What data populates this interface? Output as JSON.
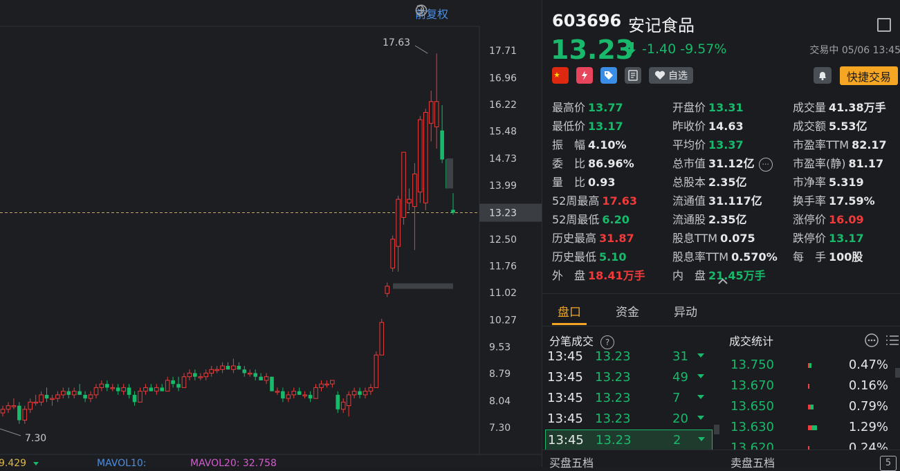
{
  "toolbar": {
    "adjust": "前复权"
  },
  "chart": {
    "price_labels": [
      "17.71",
      "16.96",
      "16.22",
      "15.48",
      "14.73",
      "13.99",
      "13.23",
      "12.50",
      "11.76",
      "11.02",
      "10.27",
      "9.53",
      "8.79",
      "8.04",
      "7.30"
    ],
    "current_price_tag": "13.23",
    "high_annotation": "17.63",
    "low_annotation": "7.30",
    "mavol_left": "9.429",
    "mavol10": "MAVOL10:",
    "mavol20": "MAVOL20: 32.758"
  },
  "chart_data": {
    "type": "candlestick",
    "series": [
      {
        "o": 7.7,
        "h": 7.9,
        "l": 7.6,
        "c": 7.8
      },
      {
        "o": 7.8,
        "h": 8.0,
        "l": 7.7,
        "c": 7.9
      },
      {
        "o": 7.9,
        "h": 8.1,
        "l": 7.8,
        "c": 7.9
      },
      {
        "o": 7.9,
        "h": 8.0,
        "l": 7.4,
        "c": 7.5
      },
      {
        "o": 7.5,
        "h": 7.9,
        "l": 7.4,
        "c": 7.8
      },
      {
        "o": 7.8,
        "h": 8.1,
        "l": 7.7,
        "c": 8.0
      },
      {
        "o": 8.0,
        "h": 8.2,
        "l": 7.9,
        "c": 8.0
      },
      {
        "o": 8.0,
        "h": 8.3,
        "l": 7.9,
        "c": 8.2
      },
      {
        "o": 8.2,
        "h": 8.4,
        "l": 8.0,
        "c": 8.1
      },
      {
        "o": 8.1,
        "h": 8.2,
        "l": 7.9,
        "c": 8.1
      },
      {
        "o": 8.1,
        "h": 8.3,
        "l": 8.0,
        "c": 8.2
      },
      {
        "o": 8.2,
        "h": 8.4,
        "l": 8.1,
        "c": 8.3
      },
      {
        "o": 8.3,
        "h": 8.4,
        "l": 8.1,
        "c": 8.2
      },
      {
        "o": 8.2,
        "h": 8.4,
        "l": 8.1,
        "c": 8.3
      },
      {
        "o": 8.3,
        "h": 8.5,
        "l": 8.2,
        "c": 8.2
      },
      {
        "o": 8.2,
        "h": 8.3,
        "l": 8.0,
        "c": 8.1
      },
      {
        "o": 8.1,
        "h": 8.3,
        "l": 8.0,
        "c": 8.2
      },
      {
        "o": 8.2,
        "h": 8.5,
        "l": 8.1,
        "c": 8.4
      },
      {
        "o": 8.4,
        "h": 8.6,
        "l": 8.3,
        "c": 8.5
      },
      {
        "o": 8.5,
        "h": 8.6,
        "l": 8.3,
        "c": 8.4
      },
      {
        "o": 8.4,
        "h": 8.5,
        "l": 8.3,
        "c": 8.4
      },
      {
        "o": 8.4,
        "h": 8.5,
        "l": 8.2,
        "c": 8.3
      },
      {
        "o": 8.3,
        "h": 8.5,
        "l": 8.2,
        "c": 8.4
      },
      {
        "o": 8.4,
        "h": 8.5,
        "l": 8.1,
        "c": 8.2
      },
      {
        "o": 8.2,
        "h": 8.3,
        "l": 7.9,
        "c": 8.0
      },
      {
        "o": 8.0,
        "h": 8.4,
        "l": 8.0,
        "c": 8.3
      },
      {
        "o": 8.3,
        "h": 8.5,
        "l": 8.2,
        "c": 8.4
      },
      {
        "o": 8.4,
        "h": 8.5,
        "l": 8.3,
        "c": 8.3
      },
      {
        "o": 8.3,
        "h": 8.5,
        "l": 8.2,
        "c": 8.4
      },
      {
        "o": 8.4,
        "h": 8.5,
        "l": 8.3,
        "c": 8.3
      },
      {
        "o": 8.3,
        "h": 8.7,
        "l": 8.3,
        "c": 8.6
      },
      {
        "o": 8.6,
        "h": 8.7,
        "l": 8.4,
        "c": 8.5
      },
      {
        "o": 8.5,
        "h": 8.7,
        "l": 8.3,
        "c": 8.4
      },
      {
        "o": 8.4,
        "h": 8.8,
        "l": 8.4,
        "c": 8.7
      },
      {
        "o": 8.7,
        "h": 8.9,
        "l": 8.6,
        "c": 8.8
      },
      {
        "o": 8.8,
        "h": 8.9,
        "l": 8.6,
        "c": 8.7
      },
      {
        "o": 8.7,
        "h": 8.8,
        "l": 8.6,
        "c": 8.7
      },
      {
        "o": 8.7,
        "h": 8.9,
        "l": 8.6,
        "c": 8.8
      },
      {
        "o": 8.8,
        "h": 9.0,
        "l": 8.7,
        "c": 8.9
      },
      {
        "o": 8.9,
        "h": 9.0,
        "l": 8.8,
        "c": 8.9
      },
      {
        "o": 8.9,
        "h": 9.1,
        "l": 8.8,
        "c": 9.0
      },
      {
        "o": 9.0,
        "h": 9.1,
        "l": 8.9,
        "c": 8.9
      },
      {
        "o": 8.9,
        "h": 9.2,
        "l": 8.8,
        "c": 9.0
      },
      {
        "o": 9.0,
        "h": 9.1,
        "l": 8.9,
        "c": 8.9
      },
      {
        "o": 8.9,
        "h": 9.0,
        "l": 8.7,
        "c": 8.8
      },
      {
        "o": 8.8,
        "h": 8.9,
        "l": 8.7,
        "c": 8.8
      },
      {
        "o": 8.8,
        "h": 8.9,
        "l": 8.6,
        "c": 8.7
      },
      {
        "o": 8.7,
        "h": 8.8,
        "l": 8.6,
        "c": 8.6
      },
      {
        "o": 8.6,
        "h": 8.8,
        "l": 8.5,
        "c": 8.7
      },
      {
        "o": 8.7,
        "h": 8.7,
        "l": 8.3,
        "c": 8.3
      },
      {
        "o": 8.3,
        "h": 8.4,
        "l": 8.2,
        "c": 8.3
      },
      {
        "o": 8.3,
        "h": 8.4,
        "l": 8.0,
        "c": 8.1
      },
      {
        "o": 8.1,
        "h": 8.3,
        "l": 8.0,
        "c": 8.2
      },
      {
        "o": 8.2,
        "h": 8.4,
        "l": 8.1,
        "c": 8.3
      },
      {
        "o": 8.3,
        "h": 8.4,
        "l": 8.2,
        "c": 8.2
      },
      {
        "o": 8.2,
        "h": 8.3,
        "l": 8.1,
        "c": 8.2
      },
      {
        "o": 8.2,
        "h": 8.3,
        "l": 8.0,
        "c": 8.1
      },
      {
        "o": 8.1,
        "h": 8.5,
        "l": 8.1,
        "c": 8.4
      },
      {
        "o": 8.4,
        "h": 8.6,
        "l": 8.3,
        "c": 8.5
      },
      {
        "o": 8.5,
        "h": 8.6,
        "l": 8.4,
        "c": 8.5
      },
      {
        "o": 8.5,
        "h": 8.6,
        "l": 8.4,
        "c": 8.6
      },
      {
        "o": 8.2,
        "h": 8.3,
        "l": 7.7,
        "c": 7.8
      },
      {
        "o": 7.8,
        "h": 8.1,
        "l": 7.7,
        "c": 8.0
      },
      {
        "o": 7.9,
        "h": 8.3,
        "l": 7.6,
        "c": 8.2
      },
      {
        "o": 8.2,
        "h": 8.4,
        "l": 8.1,
        "c": 8.3
      },
      {
        "o": 8.3,
        "h": 8.4,
        "l": 8.1,
        "c": 8.2
      },
      {
        "o": 8.2,
        "h": 8.4,
        "l": 8.1,
        "c": 8.3
      },
      {
        "o": 8.3,
        "h": 8.5,
        "l": 8.2,
        "c": 8.4
      },
      {
        "o": 8.4,
        "h": 9.4,
        "l": 8.4,
        "c": 9.3
      },
      {
        "o": 9.3,
        "h": 10.3,
        "l": 9.3,
        "c": 10.2
      },
      {
        "o": 11.0,
        "h": 11.3,
        "l": 10.9,
        "c": 11.2
      },
      {
        "o": 11.7,
        "h": 12.6,
        "l": 11.6,
        "c": 12.5
      },
      {
        "o": 12.3,
        "h": 13.7,
        "l": 11.6,
        "c": 13.6
      },
      {
        "o": 13.1,
        "h": 14.9,
        "l": 12.9,
        "c": 14.9
      },
      {
        "o": 13.5,
        "h": 13.9,
        "l": 13.3,
        "c": 13.6
      },
      {
        "o": 13.4,
        "h": 14.6,
        "l": 12.2,
        "c": 14.3
      },
      {
        "o": 13.8,
        "h": 15.9,
        "l": 13.5,
        "c": 15.8
      },
      {
        "o": 13.5,
        "h": 16.1,
        "l": 13.3,
        "c": 16.0
      },
      {
        "o": 15.7,
        "h": 16.6,
        "l": 15.2,
        "c": 16.3
      },
      {
        "o": 15.6,
        "h": 17.63,
        "l": 15.0,
        "c": 16.3
      },
      {
        "o": 15.5,
        "h": 16.2,
        "l": 14.6,
        "c": 14.7
      },
      {
        "o": 14.7,
        "h": 14.7,
        "l": 13.9,
        "c": 13.9
      },
      {
        "o": 13.31,
        "h": 13.77,
        "l": 13.17,
        "c": 13.23
      }
    ],
    "ylim": [
      7.3,
      17.71
    ]
  },
  "quote": {
    "code": "603696",
    "name": "安记食品",
    "price": "13.23",
    "change": "-1.40",
    "change_pct": "-9.57%",
    "status": "交易中 05/06 13:45",
    "watch": "自选",
    "fast_trade": "快捷交易"
  },
  "stats_col1": [
    {
      "label": "最高价",
      "value": "13.77",
      "color": "g"
    },
    {
      "label": "最低价",
      "value": "13.17",
      "color": "g"
    },
    {
      "label": "振　幅",
      "value": "4.10%",
      "color": "w"
    },
    {
      "label": "委　比",
      "value": "86.96%",
      "color": "w"
    },
    {
      "label": "量　比",
      "value": "0.93",
      "color": "w"
    },
    {
      "label": "52周最高",
      "value": "17.63",
      "color": "r"
    },
    {
      "label": "52周最低",
      "value": "6.20",
      "color": "g"
    },
    {
      "label": "历史最高",
      "value": "31.87",
      "color": "r"
    },
    {
      "label": "历史最低",
      "value": "5.10",
      "color": "g"
    },
    {
      "label": "外　盘",
      "value": "18.41万手",
      "color": "r"
    }
  ],
  "stats_col2": [
    {
      "label": "开盘价",
      "value": "13.31",
      "color": "g"
    },
    {
      "label": "昨收价",
      "value": "14.63",
      "color": "w"
    },
    {
      "label": "平均价",
      "value": "13.37",
      "color": "g"
    },
    {
      "label": "总市值",
      "value": "31.12亿",
      "color": "w"
    },
    {
      "label": "总股本",
      "value": "2.35亿",
      "color": "w"
    },
    {
      "label": "流通值",
      "value": "31.117亿",
      "color": "w"
    },
    {
      "label": "流通股",
      "value": "2.35亿",
      "color": "w"
    },
    {
      "label": "股息TTM",
      "value": "0.075",
      "color": "w"
    },
    {
      "label": "股息率TTM",
      "value": "0.570%",
      "color": "w"
    },
    {
      "label": "内　盘",
      "value": "21.45万手",
      "color": "g"
    }
  ],
  "stats_col3": [
    {
      "label": "成交量",
      "value": "41.38万手",
      "color": "w"
    },
    {
      "label": "成交额",
      "value": "5.53亿",
      "color": "w"
    },
    {
      "label": "市盈率TTM",
      "value": "82.17",
      "color": "w"
    },
    {
      "label": "市盈率(静)",
      "value": "81.17",
      "color": "w"
    },
    {
      "label": "市净率",
      "value": "5.319",
      "color": "w"
    },
    {
      "label": "换手率",
      "value": "17.59%",
      "color": "w"
    },
    {
      "label": "涨停价",
      "value": "16.09",
      "color": "r"
    },
    {
      "label": "跌停价",
      "value": "13.17",
      "color": "g"
    },
    {
      "label": "每　手",
      "value": "100股",
      "color": "w"
    }
  ],
  "tabs": [
    "盘口",
    "资金",
    "异动"
  ],
  "ticks": {
    "title": "分笔成交",
    "rows": [
      {
        "time": "13:45",
        "price": "13.23",
        "vol": "31"
      },
      {
        "time": "13:45",
        "price": "13.23",
        "vol": "49"
      },
      {
        "time": "13:45",
        "price": "13.23",
        "vol": "7"
      },
      {
        "time": "13:45",
        "price": "13.23",
        "vol": "20"
      },
      {
        "time": "13:45",
        "price": "13.23",
        "vol": "2"
      }
    ]
  },
  "trade_stats": {
    "title": "成交统计",
    "rows": [
      {
        "price": "13.750",
        "pct": "0.47%",
        "bar": 0.47
      },
      {
        "price": "13.670",
        "pct": "0.16%",
        "bar": 0.16
      },
      {
        "price": "13.650",
        "pct": "0.79%",
        "bar": 0.79
      },
      {
        "price": "13.630",
        "pct": "1.29%",
        "bar": 1.29
      },
      {
        "price": "13.620",
        "pct": "0.24%",
        "bar": 0.24
      }
    ]
  },
  "bottom": {
    "buy5": "买盘五档",
    "sell5": "卖盘五档",
    "five": "5"
  }
}
